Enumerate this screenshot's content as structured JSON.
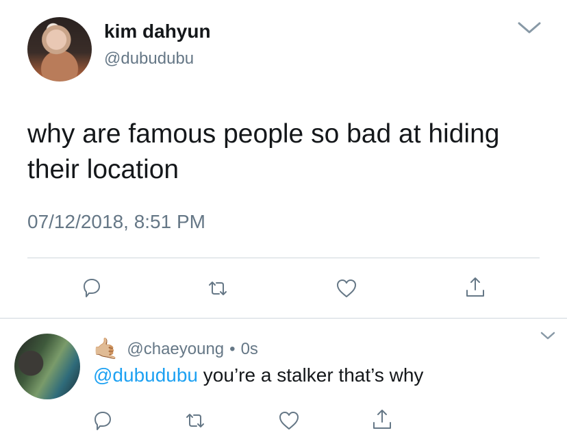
{
  "main_tweet": {
    "author_name": "kim dahyun",
    "author_handle": "@dubudubu",
    "text": "why are famous people so bad at hiding their location",
    "timestamp": "07/12/2018, 8:51 PM",
    "actions": [
      "reply-icon",
      "retweet-icon",
      "like-icon",
      "share-icon"
    ]
  },
  "reply": {
    "emoji": "🤙🏼",
    "author_handle": "@chaeyoung",
    "separator": "•",
    "age": "0s",
    "mention": "@dubudubu",
    "text": " you’re a stalker that’s why",
    "actions": [
      "reply-icon",
      "retweet-icon",
      "like-icon",
      "share-icon"
    ]
  },
  "colors": {
    "text": "#14171a",
    "muted": "#657786",
    "link": "#1da1f2",
    "divider": "#cfd6dc"
  }
}
